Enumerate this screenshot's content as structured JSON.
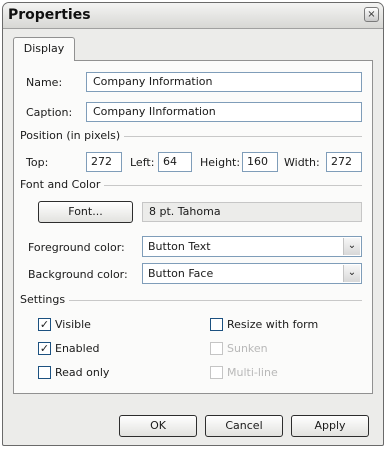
{
  "window": {
    "title": "Properties",
    "close_glyph": "×"
  },
  "tabs": [
    {
      "label": "Display",
      "active": true
    }
  ],
  "display": {
    "name_label": "Name:",
    "name_value": "Company Information",
    "caption_label": "Caption:",
    "caption_value_before": "Company I",
    "caption_cursor": "I",
    "caption_value_after": "nformation",
    "position": {
      "group_title": "Position (in pixels)",
      "top_label": "Top:",
      "top_value": "272",
      "left_label": "Left:",
      "left_value": "64",
      "height_label": "Height:",
      "height_value": "160",
      "width_label": "Width:",
      "width_value": "272"
    },
    "font_color": {
      "group_title": "Font and Color",
      "font_button_label": "Font...",
      "font_value": "8 pt. Tahoma",
      "foreground_label": "Foreground color:",
      "foreground_value": "Button Text",
      "background_label": "Background color:",
      "background_value": "Button Face"
    },
    "settings": {
      "group_title": "Settings",
      "checkboxes": [
        {
          "label": "Visible",
          "checked": true,
          "enabled": true
        },
        {
          "label": "Enabled",
          "checked": true,
          "enabled": true
        },
        {
          "label": "Read only",
          "checked": false,
          "enabled": true
        },
        {
          "label": "Resize with form",
          "checked": false,
          "enabled": true
        },
        {
          "label": "Sunken",
          "checked": false,
          "enabled": false
        },
        {
          "label": "Multi-line",
          "checked": false,
          "enabled": false
        }
      ]
    }
  },
  "footer": {
    "ok_label": "OK",
    "cancel_label": "Cancel",
    "apply_label": "Apply"
  },
  "icons": {
    "check_glyph": "✓",
    "dropdown_glyph": "⌄"
  }
}
